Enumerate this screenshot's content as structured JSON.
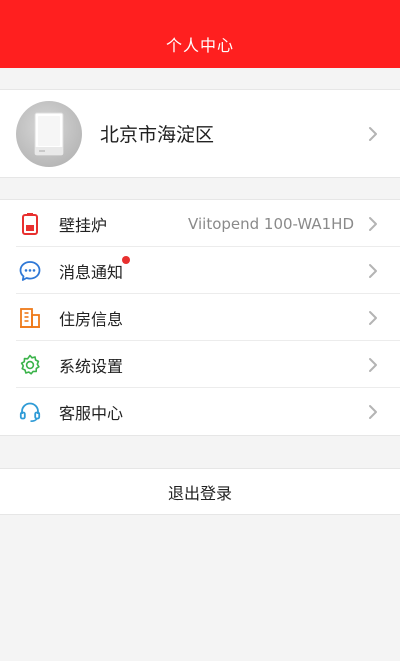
{
  "header": {
    "title": "个人中心"
  },
  "profile": {
    "name": "北京市海淀区"
  },
  "menu": {
    "items": [
      {
        "label": "壁挂炉",
        "value": "Viitopend 100-WA1HD",
        "icon": "boiler-icon"
      },
      {
        "label": "消息通知",
        "badge": true,
        "icon": "message-icon"
      },
      {
        "label": "住房信息",
        "icon": "building-icon"
      },
      {
        "label": "系统设置",
        "icon": "gear-icon"
      },
      {
        "label": "客服中心",
        "icon": "headset-icon"
      }
    ]
  },
  "logout": {
    "label": "退出登录"
  },
  "colors": {
    "header": "#ff1f1f",
    "boiler_icon": "#e8302f",
    "message_icon": "#2f78d6",
    "building_icon": "#ef7a1a",
    "gear_icon": "#3bb34a",
    "headset_icon": "#2f9bd6",
    "badge": "#e8302f"
  }
}
